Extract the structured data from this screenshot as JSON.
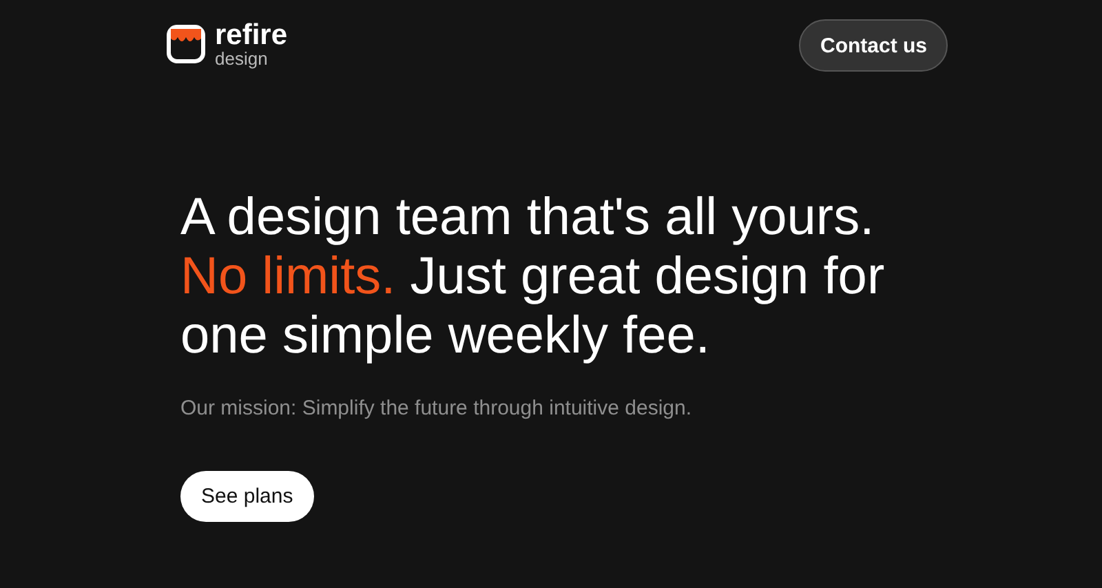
{
  "header": {
    "logo": {
      "name": "refire",
      "tagline": "design"
    },
    "contact_button": "Contact us"
  },
  "hero": {
    "headline": [
      {
        "text": "A design team that's all yours. ",
        "highlighted": false
      },
      {
        "text": "No limits.",
        "highlighted": true
      },
      {
        "text": " Just great design for one simple weekly fee.",
        "highlighted": false
      }
    ],
    "mission": "Our mission: Simplify the future through intuitive design.",
    "cta_button": "See plans"
  }
}
